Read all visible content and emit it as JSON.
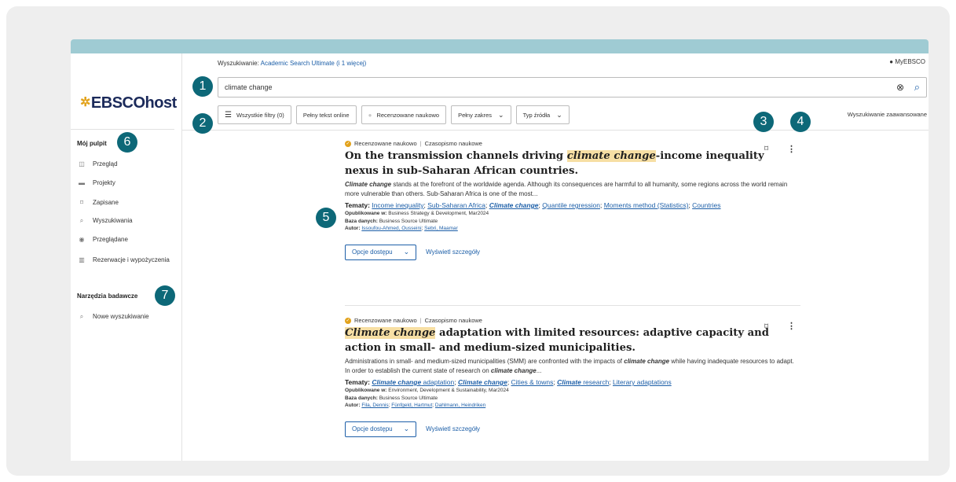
{
  "app": {
    "logo_text": "EBSCOhost",
    "search_label": "Wyszukiwanie:",
    "search_source": "Academic Search Ultimate (i 1 więcej)",
    "myebsco_label": "MyEBSCO"
  },
  "sidebar": {
    "section1_title": "Mój pulpit",
    "items": [
      {
        "label": "Przegląd",
        "icon": "overview-icon"
      },
      {
        "label": "Projekty",
        "icon": "folder-icon"
      },
      {
        "label": "Zapisane",
        "icon": "bookmark-icon"
      },
      {
        "label": "Wyszukiwania",
        "icon": "search-history-icon"
      },
      {
        "label": "Przeglądane",
        "icon": "eye-icon"
      },
      {
        "label": "Rezerwacje i wypożyczenia",
        "icon": "books-icon"
      }
    ],
    "section2_title": "Narzędzia badawcze",
    "tools": [
      {
        "label": "Nowe wyszukiwanie",
        "icon": "search-icon"
      }
    ]
  },
  "search": {
    "query": "climate change"
  },
  "filters": {
    "all_filters": "Wszystkie filtry (0)",
    "full_text": "Pełny tekst online",
    "peer_reviewed": "Recenzowane naukowo",
    "full_range": "Pełny zakres",
    "source_type": "Typ źródła",
    "advanced": "Wyszukiwanie zaawansowane"
  },
  "results": [
    {
      "peer_label": "Recenzowane naukowo",
      "type": "Czasopismo naukowe",
      "title_pre": "On the transmission channels driving ",
      "title_hl": "climate change",
      "title_post": "-income inequality nexus in sub-Saharan African countries.",
      "abstract_hl": "Climate change",
      "abstract_rest": " stands at the forefront of the worldwide agenda. Although its consequences are harmful to all humanity, some regions across the world remain more vulnerable than others. Sub-Saharan Africa is one of the most...",
      "subjects_label": "Tematy:",
      "subjects": [
        "Income inequality",
        "Sub-Saharan Africa",
        "Climate change",
        "Quantile regression",
        "Moments method (Statistics)",
        "Countries"
      ],
      "published_label": "Opublikowane w:",
      "published": "Business Strategy & Development, Mar2024",
      "database_label": "Baza danych:",
      "database": "Business Source Ultimate",
      "author_label": "Autor:",
      "authors": [
        "Issoufou-Ahmed, Ousseini",
        "Sebri, Maamar"
      ],
      "access_label": "Opcje dostępu",
      "details_label": "Wyświetl szczegóły"
    },
    {
      "peer_label": "Recenzowane naukowo",
      "type": "Czasopismo naukowe",
      "title_hl": "Climate change",
      "title_post": " adaptation with limited resources: adaptive capacity and action in small- and medium-sized municipalities.",
      "abstract_a": "Administrations in small- and medium-sized municipalities (SMM) are confronted with the impacts of ",
      "abstract_hl1": "climate change",
      "abstract_b": " while having inadequate resources to adapt. In order to establish the current state of research on ",
      "abstract_hl2": "climate change",
      "abstract_c": "...",
      "subjects_label": "Tematy:",
      "subject1_hl": "Climate change",
      "subject1_rest": " adaptation",
      "subject2": "Climate change",
      "subject3": "Cities & towns",
      "subject4_hl": "Climate",
      "subject4_rest": " research",
      "subject5": "Literary adaptations",
      "published_label": "Opublikowane w:",
      "published": "Environment, Development & Sustainability, Mar2024",
      "database_label": "Baza danych:",
      "database": "Business Source Ultimate",
      "author_label": "Autor:",
      "authors": [
        "Fila, Dennis",
        "Fünfgeld, Hartmut",
        "Dahlmann, Heindriken"
      ],
      "access_label": "Opcje dostępu",
      "details_label": "Wyświetl szczegóły"
    }
  ],
  "callouts": [
    "1",
    "2",
    "3",
    "4",
    "5",
    "6",
    "7"
  ],
  "colors": {
    "accent": "#1d5fa8",
    "badge": "#0d6878",
    "highlight": "#f7dfa4",
    "topbar": "#9fcbd3"
  }
}
